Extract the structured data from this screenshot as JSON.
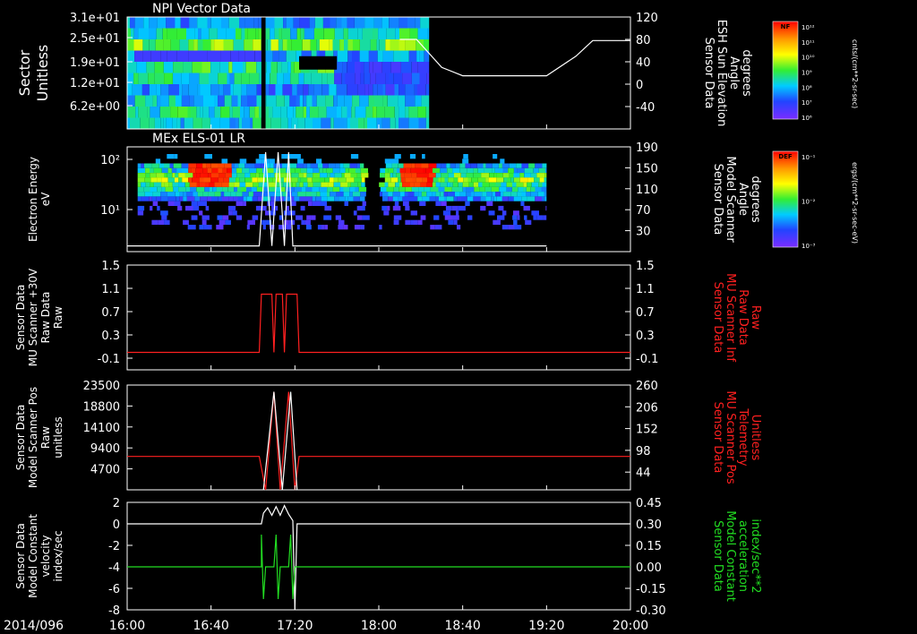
{
  "date_label": "2014/096",
  "x_axis": {
    "range": [
      "16:00",
      "20:00"
    ],
    "tick_labels": [
      "16:00",
      "16:40",
      "17:20",
      "18:00",
      "18:40",
      "19:20",
      "20:00"
    ]
  },
  "colorbars": [
    {
      "title": "NF",
      "unit_label": "cnts/(cm**2-sr-sec)",
      "tick_labels": [
        "10¹²",
        "10¹¹",
        "10¹⁰",
        "10⁹",
        "10⁸",
        "10⁷",
        "10⁶"
      ]
    },
    {
      "title": "DEF",
      "unit_label": "ergs/(cm**2-sr-sec-eV)",
      "tick_labels": [
        "10⁻¹",
        "10⁻²",
        "10⁻³"
      ]
    }
  ],
  "colors": {
    "background": "#000000",
    "axes": "#ffffff",
    "red_trace": "#ff2020",
    "green_trace": "#22dd22",
    "white_trace": "#ffffff"
  },
  "chart_data": [
    {
      "type": "heatmap",
      "title": "NPI Vector Data",
      "ylabel_lines": [
        "Sector",
        "Unitless"
      ],
      "ytick_labels": [
        "3.1e+01",
        "2.5e+01",
        "1.9e+01",
        "1.2e+01",
        "6.2e+00"
      ],
      "right_axis": {
        "label_lines": [
          "Sensor Data",
          "ESH Sun Elevation",
          "Angle",
          "degrees"
        ],
        "label_color": "#ffffff",
        "ticks": [
          120,
          80,
          40,
          0,
          -40
        ],
        "ylim": [
          -80,
          120
        ]
      },
      "overlay_series": {
        "color": "#ffffff",
        "points": [
          [
            "18:10",
            80
          ],
          [
            "18:18",
            80
          ],
          [
            "18:30",
            30
          ],
          [
            "18:40",
            15
          ],
          [
            "19:20",
            15
          ],
          [
            "19:34",
            50
          ],
          [
            "19:42",
            78
          ],
          [
            "20:00",
            78
          ]
        ]
      },
      "data_extent": [
        "16:00",
        "18:24"
      ]
    },
    {
      "type": "heatmap",
      "title": "MEx ELS-01 LR",
      "ylabel_lines": [
        "Electron Energy",
        "eV"
      ],
      "ytick_labels": [
        "10²",
        "10¹"
      ],
      "right_axis": {
        "label_lines": [
          "Sensor Data",
          "Model Scanner",
          "Angle",
          "degrees"
        ],
        "label_color": "#ffffff",
        "ticks": [
          190,
          150,
          110,
          70,
          30
        ],
        "ylim": [
          -10,
          190
        ]
      },
      "overlay_series": {
        "color": "#ffffff",
        "points": [
          [
            "16:00",
            1
          ],
          [
            "17:03",
            1
          ],
          [
            "17:06",
            180
          ],
          [
            "17:09",
            1
          ],
          [
            "17:12",
            180
          ],
          [
            "17:15",
            1
          ],
          [
            "17:17",
            180
          ],
          [
            "17:19",
            1
          ],
          [
            "19:20",
            1
          ]
        ]
      },
      "data_extent": [
        "16:05",
        "19:20"
      ]
    },
    {
      "type": "line",
      "ylabel_lines": [
        "Sensor Data",
        "MU Scanner +30V",
        "Raw Data",
        "Raw"
      ],
      "ylim": [
        -0.3,
        1.5
      ],
      "ytick_labels": [
        1.5,
        1.1,
        0.7,
        0.3,
        -0.1
      ],
      "right_axis": {
        "label_lines": [
          "Sensor Data",
          "MU Scanner Inf",
          "Raw Data",
          "Raw"
        ],
        "label_color": "#ff2020",
        "ticks": [
          1.5,
          1.1,
          0.7,
          0.3,
          -0.1
        ],
        "ylim": [
          -0.3,
          1.5
        ]
      },
      "series": [
        {
          "color": "#ff2020",
          "points": [
            [
              "16:00",
              0
            ],
            [
              "17:03",
              0
            ],
            [
              "17:04",
              1
            ],
            [
              "17:09",
              1
            ],
            [
              "17:10",
              0
            ],
            [
              "17:11",
              1
            ],
            [
              "17:14",
              1
            ],
            [
              "17:15",
              0
            ],
            [
              "17:16",
              1
            ],
            [
              "17:21",
              1
            ],
            [
              "17:22",
              0
            ],
            [
              "20:00",
              0
            ]
          ]
        }
      ]
    },
    {
      "type": "line",
      "ylabel_lines": [
        "Sensor Data",
        "Model Scanner Pos",
        "Raw",
        "unitless"
      ],
      "ylim": [
        0,
        23500
      ],
      "ytick_labels": [
        23500,
        18800,
        14100,
        9400,
        4700
      ],
      "right_axis": {
        "label_lines": [
          "Sensor Data",
          "MU Scanner Pos",
          "Telemetry",
          "Unitless"
        ],
        "label_color": "#ff2020",
        "ticks": [
          260,
          206,
          152,
          98,
          44
        ],
        "ylim": [
          0,
          260
        ]
      },
      "series": [
        {
          "color": "#ff2020",
          "points": [
            [
              "16:00",
              7500
            ],
            [
              "17:03",
              7500
            ],
            [
              "17:06",
              0
            ],
            [
              "17:10",
              22000
            ],
            [
              "17:13",
              0
            ],
            [
              "17:17",
              22000
            ],
            [
              "17:20",
              0
            ],
            [
              "17:22",
              7500
            ],
            [
              "20:00",
              7500
            ]
          ]
        },
        {
          "color": "#ffffff",
          "points": [
            [
              "17:05",
              0
            ],
            [
              "17:10",
              22000
            ],
            [
              "17:14",
              0
            ],
            [
              "17:18",
              22000
            ],
            [
              "17:21",
              0
            ]
          ]
        }
      ]
    },
    {
      "type": "line",
      "ylabel_lines": [
        "Sensor Data",
        "Model Constant",
        "velocity",
        "index/sec"
      ],
      "ylim": [
        -8,
        2
      ],
      "ytick_labels": [
        2,
        0,
        -2,
        -4,
        -6,
        -8
      ],
      "right_axis": {
        "label_lines": [
          "Sensor Data",
          "Model Constant",
          "acceleration",
          "index/sec**2"
        ],
        "label_color": "#22dd22",
        "ticks": [
          "0.45",
          "0.30",
          "0.15",
          "0.00",
          "-0.15",
          "-0.30"
        ],
        "tick_values": [
          0.45,
          0.3,
          0.15,
          0.0,
          -0.15,
          -0.3
        ],
        "ylim": [
          -0.3,
          0.45
        ]
      },
      "series": [
        {
          "color": "#ffffff",
          "points": [
            [
              "16:00",
              0
            ],
            [
              "17:04",
              0
            ],
            [
              "17:05",
              1
            ],
            [
              "17:07",
              1.5
            ],
            [
              "17:09",
              0.8
            ],
            [
              "17:11",
              1.6
            ],
            [
              "17:13",
              0.8
            ],
            [
              "17:15",
              1.7
            ],
            [
              "17:17",
              0.9
            ],
            [
              "17:19",
              0.3
            ],
            [
              "17:20",
              -8
            ],
            [
              "17:21",
              0
            ],
            [
              "20:00",
              0
            ]
          ]
        },
        {
          "color": "#22dd22",
          "points": [
            [
              "16:00",
              -4
            ],
            [
              "17:04",
              -4
            ],
            [
              "17:04",
              -1
            ],
            [
              "17:05",
              -7
            ],
            [
              "17:06",
              -4
            ],
            [
              "17:10",
              -4
            ],
            [
              "17:11",
              -1
            ],
            [
              "17:12",
              -7
            ],
            [
              "17:13",
              -4
            ],
            [
              "17:17",
              -4
            ],
            [
              "17:18",
              -1
            ],
            [
              "17:19",
              -7
            ],
            [
              "17:20",
              -4
            ],
            [
              "20:00",
              -4
            ]
          ]
        }
      ]
    }
  ]
}
